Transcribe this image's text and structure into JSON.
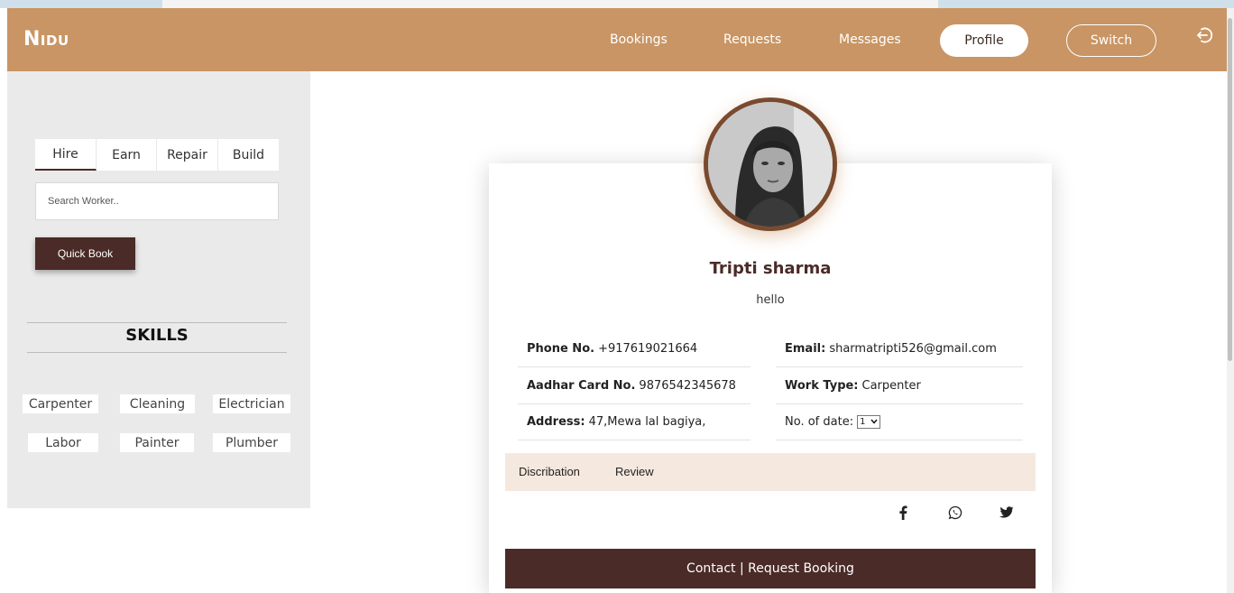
{
  "brand": "Nidu",
  "nav": {
    "bookings": "Bookings",
    "requests": "Requests",
    "messages": "Messages",
    "profile": "Profile",
    "switch": "Switch",
    "logout_icon": "logout-icon"
  },
  "sidebar": {
    "tabs": [
      "Hire",
      "Earn",
      "Repair",
      "Build"
    ],
    "active_tab": "Hire",
    "search_placeholder": "Search Worker..",
    "quick_book": "Quick Book",
    "skills_title": "SKILLS",
    "skills": [
      "Carpenter",
      "Cleaning",
      "Electrician",
      "Labor",
      "Painter",
      "Plumber"
    ]
  },
  "profile": {
    "name": "Tripti sharma",
    "bio": "hello",
    "phone_label": "Phone No.",
    "phone": "+917619021664",
    "email_label": "Email:",
    "email": "sharmatripti526@gmail.com",
    "aadhar_label": "Aadhar Card No.",
    "aadhar": "9876542345678",
    "work_type_label": "Work Type:",
    "work_type": "Carpenter",
    "address_label": "Address:",
    "address": "47,Mewa lal bagiya,",
    "no_of_date_label": "No. of date:",
    "no_of_date_value": "1",
    "tabs": [
      "Discribation",
      "Review"
    ],
    "social_icons": [
      "facebook-icon",
      "whatsapp-icon",
      "twitter-icon"
    ],
    "contact_button": "Contact | Request Booking"
  },
  "colors": {
    "navbar": "#c99564",
    "accent_dark": "#4b2b27",
    "sidebar_bg": "#eaeaea",
    "tab_strip": "#f5e8de"
  }
}
